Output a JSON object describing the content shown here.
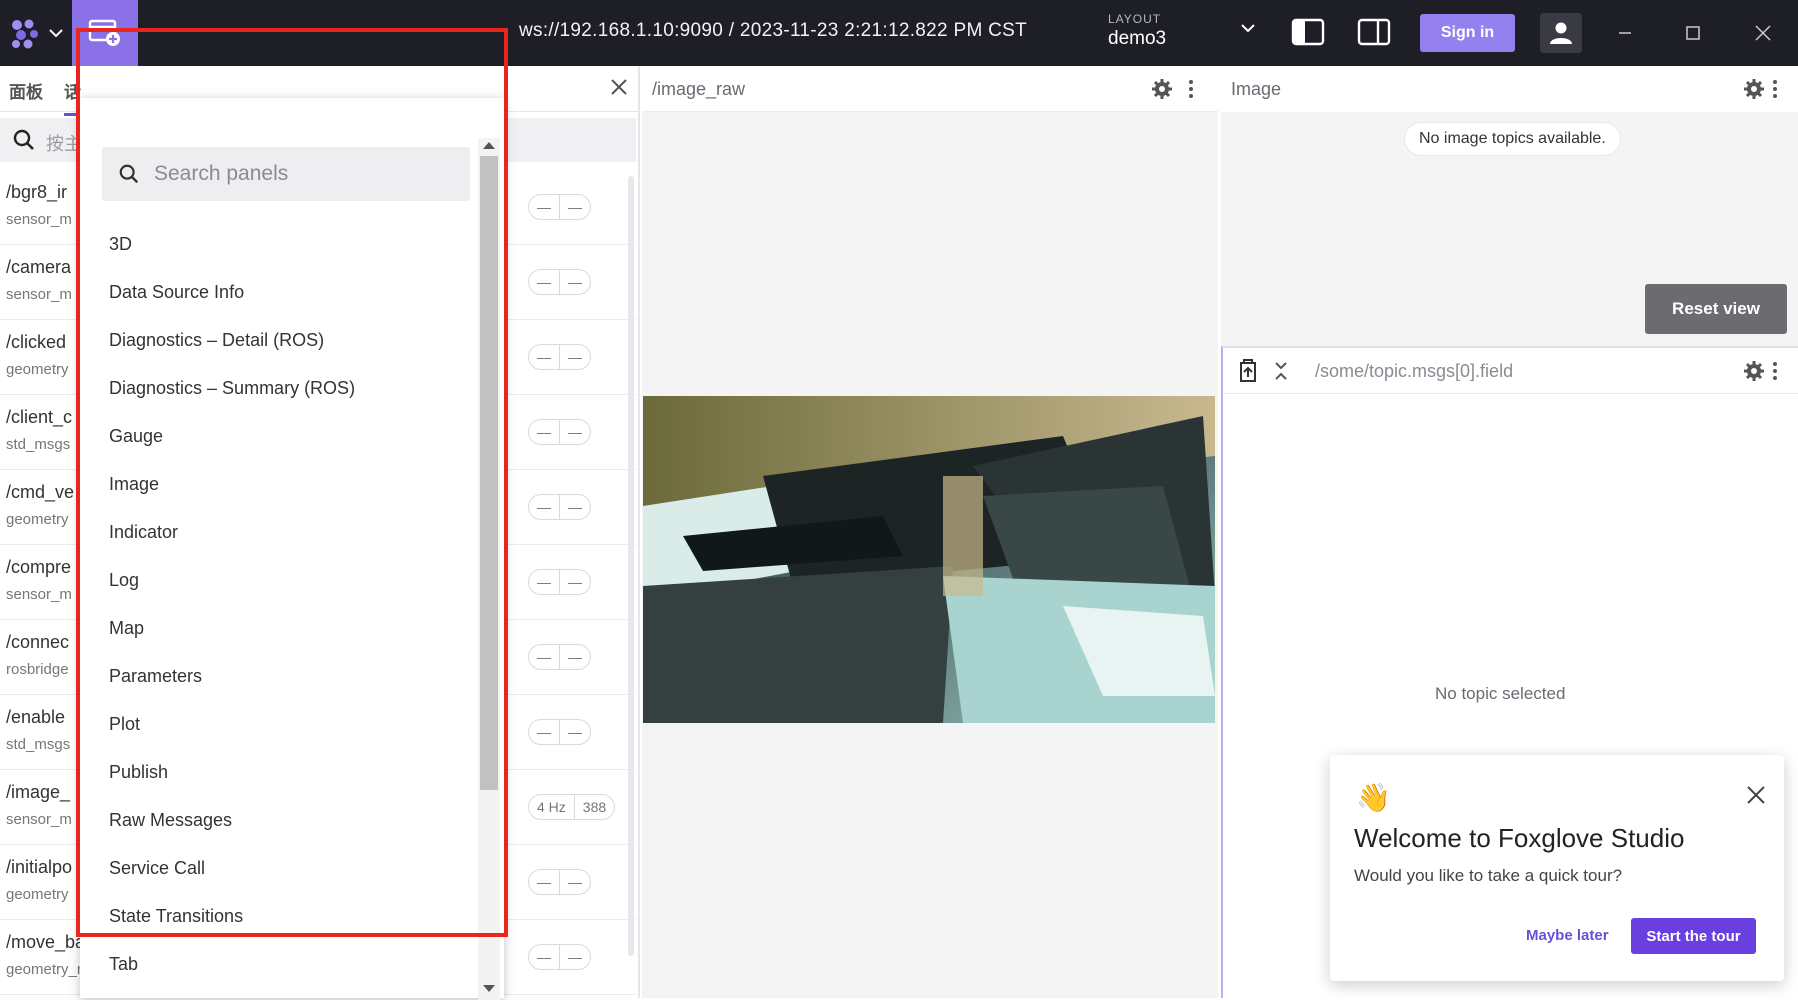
{
  "topbar": {
    "connection": "ws://192.168.1.10:9090 / 2023-11-23 2:21:12.822 PM CST",
    "layout_label": "LAYOUT",
    "layout_name": "demo3",
    "sign_in": "Sign in"
  },
  "left_panel": {
    "tabs": [
      "面板",
      "话"
    ],
    "search_placeholder": "按主",
    "topics": [
      {
        "name": "/bgr8_ir",
        "type": "sensor_m",
        "stats": [
          "—",
          "—"
        ]
      },
      {
        "name": "/camera",
        "type": "sensor_m",
        "stats": [
          "—",
          "—"
        ]
      },
      {
        "name": "/clicked",
        "type": "geometry",
        "stats": [
          "—",
          "—"
        ]
      },
      {
        "name": "/client_c",
        "type": "std_msgs",
        "stats": [
          "—",
          "—"
        ]
      },
      {
        "name": "/cmd_ve",
        "type": "geometry",
        "stats": [
          "—",
          "—"
        ]
      },
      {
        "name": "/compre",
        "type": "sensor_m",
        "stats": [
          "—",
          "—"
        ]
      },
      {
        "name": "/connec",
        "type": "rosbridge",
        "stats": [
          "—",
          "—"
        ]
      },
      {
        "name": "/enable",
        "type": "std_msgs",
        "stats": [
          "—",
          "—"
        ]
      },
      {
        "name": "/image_",
        "type": "sensor_m",
        "stats": [
          "4 Hz",
          "388"
        ]
      },
      {
        "name": "/initialpo",
        "type": "geometry",
        "stats": [
          "—",
          "—"
        ]
      },
      {
        "name": "/move_base_simple/goal",
        "type": "geometry_msgs/msg/PoseStamped",
        "stats": [
          "—",
          "—"
        ]
      }
    ]
  },
  "panel_menu": {
    "search_placeholder": "Search panels",
    "items": [
      "3D",
      "Data Source Info",
      "Diagnostics – Detail (ROS)",
      "Diagnostics – Summary (ROS)",
      "Gauge",
      "Image",
      "Indicator",
      "Log",
      "Map",
      "Parameters",
      "Plot",
      "Publish",
      "Raw Messages",
      "Service Call",
      "State Transitions",
      "Tab"
    ]
  },
  "panels": {
    "image_raw": {
      "title": "/image_raw"
    },
    "image": {
      "title": "Image",
      "message": "No image topics available.",
      "reset_view": "Reset view"
    },
    "raw": {
      "title": "/some/topic.msgs[0].field",
      "message": "No topic selected"
    }
  },
  "welcome": {
    "emoji": "👋",
    "title": "Welcome to Foxglove Studio",
    "subtitle": "Would you like to take a quick tour?",
    "maybe_later": "Maybe later",
    "start_tour": "Start the tour"
  }
}
